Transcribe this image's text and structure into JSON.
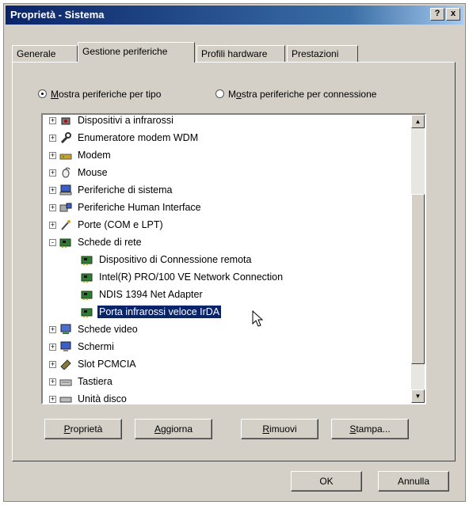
{
  "window": {
    "title": "Proprietà - Sistema",
    "help_button": "?",
    "close_button": "x"
  },
  "tabs": [
    {
      "label": "Generale"
    },
    {
      "label": "Gestione periferiche"
    },
    {
      "label": "Profili hardware"
    },
    {
      "label": "Prestazioni"
    }
  ],
  "active_tab": "Gestione periferiche",
  "view_options": {
    "by_type": {
      "mnemonic": "M",
      "rest": "ostra periferiche per tipo",
      "selected": true
    },
    "by_connection": {
      "pre": "M",
      "mnemonic": "o",
      "rest": "stra periferiche per connessione",
      "selected": false
    }
  },
  "tree": {
    "items": [
      {
        "label": "Dispositivi a infrarossi",
        "icon": "infrared-icon",
        "expander": "+"
      },
      {
        "label": "Enumeratore modem WDM",
        "icon": "wrench-icon",
        "expander": "+"
      },
      {
        "label": "Modem",
        "icon": "modem-icon",
        "expander": "+"
      },
      {
        "label": "Mouse",
        "icon": "mouse-icon",
        "expander": "+"
      },
      {
        "label": "Periferiche di sistema",
        "icon": "computer-icon",
        "expander": "+"
      },
      {
        "label": "Periferiche Human Interface",
        "icon": "hid-icon",
        "expander": "+"
      },
      {
        "label": "Porte (COM e LPT)",
        "icon": "port-icon",
        "expander": "+"
      },
      {
        "label": "Schede di rete",
        "icon": "network-card-icon",
        "expander": "-"
      },
      {
        "label": "Dispositivo di Connessione remota",
        "icon": "network-card-icon",
        "child": true
      },
      {
        "label": "Intel(R) PRO/100 VE Network Connection",
        "icon": "network-card-icon",
        "child": true
      },
      {
        "label": "NDIS 1394 Net Adapter",
        "icon": "network-card-icon",
        "child": true
      },
      {
        "label": "Porta infrarossi veloce IrDA",
        "icon": "network-card-icon",
        "child": true,
        "selected": true
      },
      {
        "label": "Schede video",
        "icon": "display-adapter-icon",
        "expander": "+"
      },
      {
        "label": "Schermi",
        "icon": "monitor-icon",
        "expander": "+"
      },
      {
        "label": "Slot PCMCIA",
        "icon": "pcmcia-icon",
        "expander": "+"
      },
      {
        "label": "Tastiera",
        "icon": "keyboard-icon",
        "expander": "+"
      },
      {
        "label": "Unità disco",
        "icon": "disk-icon",
        "expander": "+"
      }
    ]
  },
  "action_buttons": [
    {
      "mnemonic": "P",
      "rest": "roprietà"
    },
    {
      "mnemonic": "A",
      "rest": "ggiorna"
    },
    {
      "mnemonic": "R",
      "rest": "imuovi"
    },
    {
      "mnemonic": "S",
      "rest": "tampa..."
    }
  ],
  "dialog_buttons": {
    "ok": "OK",
    "cancel": "Annulla"
  },
  "colors": {
    "title_bar": "#0a246a",
    "selection": "#0a246a",
    "face": "#d4d0c8"
  }
}
